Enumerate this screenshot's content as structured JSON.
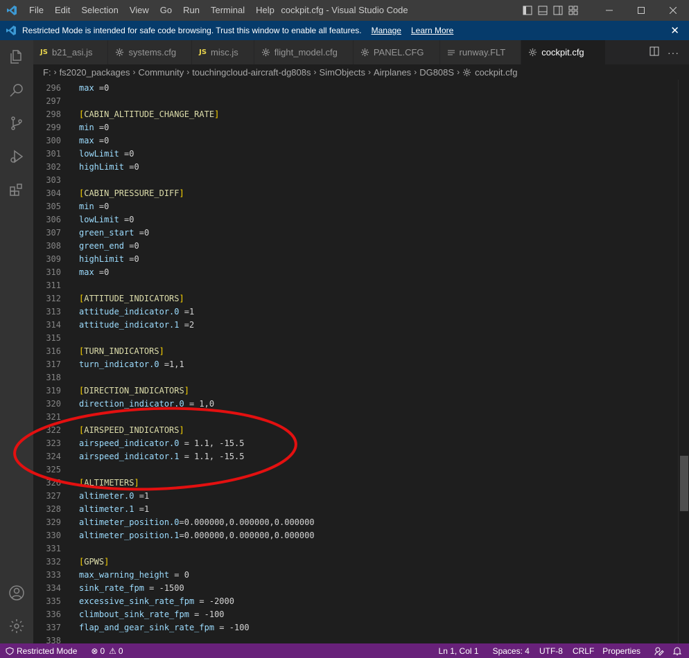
{
  "window": {
    "title": "cockpit.cfg - Visual Studio Code"
  },
  "menu": [
    "File",
    "Edit",
    "Selection",
    "View",
    "Go",
    "Run",
    "Terminal",
    "Help"
  ],
  "banner": {
    "message": "Restricted Mode is intended for safe code browsing. Trust this window to enable all features.",
    "manage_link": "Manage",
    "learn_more_link": "Learn More"
  },
  "tabs": [
    {
      "label": "b21_asi.js",
      "icon": "js-icon",
      "active": false
    },
    {
      "label": "systems.cfg",
      "icon": "gear-icon",
      "active": false
    },
    {
      "label": "misc.js",
      "icon": "js-icon",
      "active": false
    },
    {
      "label": "flight_model.cfg",
      "icon": "gear-icon",
      "active": false
    },
    {
      "label": "PANEL.CFG",
      "icon": "gear-icon",
      "active": false
    },
    {
      "label": "runway.FLT",
      "icon": "lines-icon",
      "active": false
    },
    {
      "label": "cockpit.cfg",
      "icon": "gear-icon",
      "active": true
    }
  ],
  "breadcrumb": {
    "parts": [
      "F:",
      "fs2020_packages",
      "Community",
      "touchingcloud-aircraft-dg808s",
      "SimObjects",
      "Airplanes",
      "DG808S",
      "cockpit.cfg"
    ]
  },
  "editor": {
    "lines": [
      {
        "n": "296",
        "text": "max =0"
      },
      {
        "n": "297",
        "text": ""
      },
      {
        "n": "298",
        "text": "[CABIN_ALTITUDE_CHANGE_RATE]"
      },
      {
        "n": "299",
        "text": "min =0"
      },
      {
        "n": "300",
        "text": "max =0"
      },
      {
        "n": "301",
        "text": "lowLimit =0"
      },
      {
        "n": "302",
        "text": "highLimit =0"
      },
      {
        "n": "303",
        "text": ""
      },
      {
        "n": "304",
        "text": "[CABIN_PRESSURE_DIFF]"
      },
      {
        "n": "305",
        "text": "min =0"
      },
      {
        "n": "306",
        "text": "lowLimit =0"
      },
      {
        "n": "307",
        "text": "green_start =0"
      },
      {
        "n": "308",
        "text": "green_end =0"
      },
      {
        "n": "309",
        "text": "highLimit =0"
      },
      {
        "n": "310",
        "text": "max =0"
      },
      {
        "n": "311",
        "text": ""
      },
      {
        "n": "312",
        "text": "[ATTITUDE_INDICATORS]"
      },
      {
        "n": "313",
        "text": "attitude_indicator.0 =1"
      },
      {
        "n": "314",
        "text": "attitude_indicator.1 =2"
      },
      {
        "n": "315",
        "text": ""
      },
      {
        "n": "316",
        "text": "[TURN_INDICATORS]"
      },
      {
        "n": "317",
        "text": "turn_indicator.0 =1,1"
      },
      {
        "n": "318",
        "text": ""
      },
      {
        "n": "319",
        "text": "[DIRECTION_INDICATORS]"
      },
      {
        "n": "320",
        "text": "direction_indicator.0 = 1,0"
      },
      {
        "n": "321",
        "text": ""
      },
      {
        "n": "322",
        "text": "[AIRSPEED_INDICATORS]"
      },
      {
        "n": "323",
        "text": "airspeed_indicator.0 = 1.1, -15.5"
      },
      {
        "n": "324",
        "text": "airspeed_indicator.1 = 1.1, -15.5"
      },
      {
        "n": "325",
        "text": ""
      },
      {
        "n": "326",
        "text": "[ALTIMETERS]"
      },
      {
        "n": "327",
        "text": "altimeter.0 =1"
      },
      {
        "n": "328",
        "text": "altimeter.1 =1"
      },
      {
        "n": "329",
        "text": "altimeter_position.0=0.000000,0.000000,0.000000"
      },
      {
        "n": "330",
        "text": "altimeter_position.1=0.000000,0.000000,0.000000"
      },
      {
        "n": "331",
        "text": ""
      },
      {
        "n": "332",
        "text": "[GPWS]"
      },
      {
        "n": "333",
        "text": "max_warning_height = 0"
      },
      {
        "n": "334",
        "text": "sink_rate_fpm = -1500"
      },
      {
        "n": "335",
        "text": "excessive_sink_rate_fpm = -2000"
      },
      {
        "n": "336",
        "text": "climbout_sink_rate_fpm = -100"
      },
      {
        "n": "337",
        "text": "flap_and_gear_sink_rate_fpm = -100"
      },
      {
        "n": "338",
        "text": ""
      }
    ]
  },
  "statusbar": {
    "restricted": "Restricted Mode",
    "errors": "0",
    "warnings": "0",
    "position": "Ln 1, Col 1",
    "spaces": "Spaces: 4",
    "encoding": "UTF-8",
    "eol": "CRLF",
    "language": "Properties"
  },
  "colors": {
    "statusbar": "#68217a",
    "banner": "#063b6b",
    "annotation": "#e31010"
  }
}
